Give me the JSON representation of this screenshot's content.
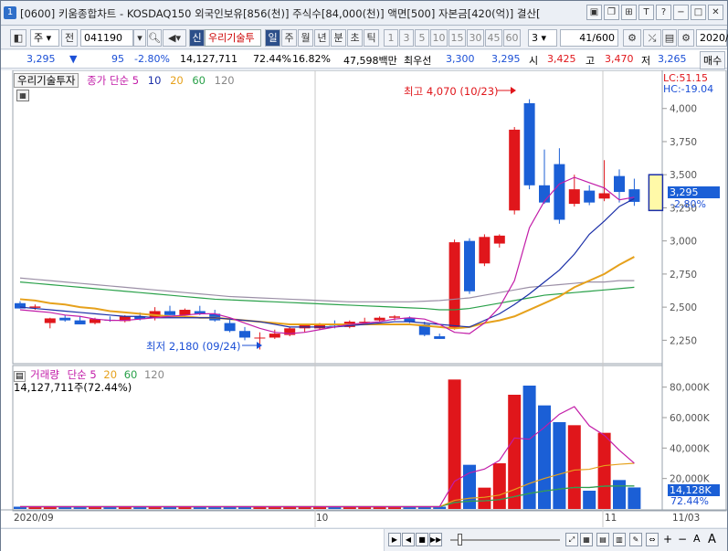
{
  "window": {
    "num": "1",
    "title": "[0600] 키움종합차트 - KOSDAQ150 외국인보유[856(천)] 주식수[84,000(천)] 액면[500] 자본금[420(억)] 결산[",
    "buttons": [
      "minimize-icon",
      "restore-icon",
      "tile-icon",
      "font-icon",
      "help-icon",
      "min-icon",
      "max-icon",
      "close-icon"
    ]
  },
  "toolbar": {
    "period": "주",
    "prev": "전",
    "code": "041190",
    "badge": "신",
    "name": "우리기술투",
    "timeframes": [
      "일",
      "주",
      "월",
      "년",
      "분",
      "초",
      "틱"
    ],
    "minutes": [
      "1",
      "3",
      "5",
      "10",
      "15",
      "30",
      "45",
      "60"
    ],
    "interval": "3",
    "count": "41/600",
    "date": "2020/"
  },
  "pricebar": {
    "price": "3,295",
    "arrow": "▼",
    "change": "95",
    "change_pct": "-2.80%",
    "volume": "14,127,711",
    "vol_ratio": "72.44%",
    "turnover": "16.82%",
    "amount": "47,598백만",
    "best_label": "최우선",
    "ask": "3,300",
    "bid": "3,295",
    "open_label": "시",
    "open": "3,425",
    "high_label": "고",
    "high": "3,470",
    "low_label": "저",
    "low": "3,265",
    "right_btn": "매수"
  },
  "price_legend": {
    "name": "우리기술투자",
    "ma_label": "종가 단순",
    "periods": [
      "5",
      "10",
      "20",
      "60",
      "120"
    ],
    "lc": "LC:51.15",
    "hc": "HC:-19.04",
    "high_note": "최고 4,070 (10/23)",
    "low_note": "최저 2,180 (09/24)",
    "last_price": "3,295",
    "last_pct": "-2.80%"
  },
  "volume_legend": {
    "label": "거래량",
    "ma_label": "단순",
    "periods": [
      "5",
      "20",
      "60",
      "120"
    ],
    "value": "14,127,711주(72.44%)",
    "last_volume": "14,128K",
    "last_pct": "72.44%"
  },
  "x_axis": {
    "labels": [
      "2020/09",
      "10",
      "11",
      "11/03"
    ]
  },
  "colors": {
    "up": "#e0161b",
    "down": "#1b5fd6",
    "ma5": "#c21ca8",
    "ma10": "#1b2fa8",
    "ma20": "#e6a11c",
    "ma60": "#2aa14a",
    "ma120": "#9b8fa6"
  },
  "chart_data": {
    "type": "candlestick",
    "y_price_ticks": [
      "4,000",
      "3,750",
      "3,500",
      "3,250",
      "3,000",
      "2,750",
      "2,500",
      "2,250"
    ],
    "y_price_range": [
      2080,
      4150
    ],
    "y_volume_ticks": [
      "80,000K",
      "60,000K",
      "40,000K",
      "20,000K"
    ],
    "y_volume_range": [
      0,
      90000
    ],
    "candles": [
      {
        "o": 2530,
        "h": 2545,
        "l": 2490,
        "c": 2490,
        "v": 1500
      },
      {
        "o": 2495,
        "h": 2520,
        "l": 2480,
        "c": 2505,
        "v": 1500
      },
      {
        "o": 2380,
        "h": 2420,
        "l": 2340,
        "c": 2415,
        "v": 1500
      },
      {
        "o": 2420,
        "h": 2440,
        "l": 2390,
        "c": 2400,
        "v": 1500
      },
      {
        "o": 2400,
        "h": 2430,
        "l": 2370,
        "c": 2370,
        "v": 1500
      },
      {
        "o": 2380,
        "h": 2420,
        "l": 2370,
        "c": 2410,
        "v": 1500
      },
      {
        "o": 2405,
        "h": 2430,
        "l": 2390,
        "c": 2400,
        "v": 1500
      },
      {
        "o": 2395,
        "h": 2440,
        "l": 2385,
        "c": 2430,
        "v": 1500
      },
      {
        "o": 2430,
        "h": 2460,
        "l": 2400,
        "c": 2410,
        "v": 1500
      },
      {
        "o": 2420,
        "h": 2500,
        "l": 2400,
        "c": 2470,
        "v": 1500
      },
      {
        "o": 2470,
        "h": 2510,
        "l": 2440,
        "c": 2440,
        "v": 1500
      },
      {
        "o": 2440,
        "h": 2490,
        "l": 2420,
        "c": 2480,
        "v": 1500
      },
      {
        "o": 2470,
        "h": 2510,
        "l": 2440,
        "c": 2450,
        "v": 1500
      },
      {
        "o": 2450,
        "h": 2480,
        "l": 2390,
        "c": 2400,
        "v": 1500
      },
      {
        "o": 2380,
        "h": 2420,
        "l": 2310,
        "c": 2320,
        "v": 1500
      },
      {
        "o": 2320,
        "h": 2350,
        "l": 2250,
        "c": 2270,
        "v": 1500
      },
      {
        "o": 2270,
        "h": 2310,
        "l": 2180,
        "c": 2270,
        "v": 1500
      },
      {
        "o": 2270,
        "h": 2330,
        "l": 2260,
        "c": 2300,
        "v": 1500
      },
      {
        "o": 2290,
        "h": 2350,
        "l": 2280,
        "c": 2340,
        "v": 1500
      },
      {
        "o": 2340,
        "h": 2370,
        "l": 2310,
        "c": 2370,
        "v": 1500
      },
      {
        "o": 2340,
        "h": 2380,
        "l": 2330,
        "c": 2370,
        "v": 1500
      },
      {
        "o": 2370,
        "h": 2400,
        "l": 2340,
        "c": 2360,
        "v": 1500
      },
      {
        "o": 2350,
        "h": 2400,
        "l": 2340,
        "c": 2390,
        "v": 1500
      },
      {
        "o": 2390,
        "h": 2420,
        "l": 2370,
        "c": 2390,
        "v": 1500
      },
      {
        "o": 2400,
        "h": 2430,
        "l": 2390,
        "c": 2420,
        "v": 1500
      },
      {
        "o": 2420,
        "h": 2440,
        "l": 2400,
        "c": 2430,
        "v": 1500
      },
      {
        "o": 2420,
        "h": 2430,
        "l": 2380,
        "c": 2390,
        "v": 1500
      },
      {
        "o": 2370,
        "h": 2390,
        "l": 2280,
        "c": 2290,
        "v": 1500
      },
      {
        "o": 2280,
        "h": 2300,
        "l": 2260,
        "c": 2260,
        "v": 1500
      },
      {
        "o": 2340,
        "h": 3010,
        "l": 2330,
        "c": 2990,
        "v": 85000
      },
      {
        "o": 3000,
        "h": 3020,
        "l": 2600,
        "c": 2620,
        "v": 29000
      },
      {
        "o": 2830,
        "h": 3050,
        "l": 2810,
        "c": 3030,
        "v": 14000
      },
      {
        "o": 2980,
        "h": 3050,
        "l": 2950,
        "c": 3040,
        "v": 30000
      },
      {
        "o": 3230,
        "h": 3860,
        "l": 3200,
        "c": 3840,
        "v": 75000
      },
      {
        "o": 4040,
        "h": 4070,
        "l": 3390,
        "c": 3420,
        "v": 81000
      },
      {
        "o": 3420,
        "h": 3690,
        "l": 3280,
        "c": 3290,
        "v": 68000
      },
      {
        "o": 3580,
        "h": 3700,
        "l": 3130,
        "c": 3160,
        "v": 57000
      },
      {
        "o": 3280,
        "h": 3500,
        "l": 3260,
        "c": 3390,
        "v": 55000
      },
      {
        "o": 3380,
        "h": 3420,
        "l": 3270,
        "c": 3290,
        "v": 12000
      },
      {
        "o": 3320,
        "h": 3610,
        "l": 3300,
        "c": 3360,
        "v": 50000
      },
      {
        "o": 3490,
        "h": 3540,
        "l": 3290,
        "c": 3370,
        "v": 19000
      },
      {
        "o": 3390,
        "h": 3470,
        "l": 3265,
        "c": 3295,
        "v": 14128
      }
    ],
    "ma5": [
      2480,
      2470,
      2460,
      2440,
      2430,
      2410,
      2400,
      2400,
      2410,
      2420,
      2430,
      2440,
      2450,
      2450,
      2420,
      2380,
      2340,
      2310,
      2300,
      2310,
      2330,
      2350,
      2370,
      2380,
      2390,
      2410,
      2420,
      2410,
      2370,
      2310,
      2300,
      2380,
      2500,
      2700,
      3100,
      3300,
      3430,
      3480,
      3440,
      3400,
      3310,
      3330
    ],
    "ma10": [
      2500,
      2490,
      2480,
      2470,
      2460,
      2450,
      2440,
      2430,
      2430,
      2420,
      2420,
      2420,
      2420,
      2420,
      2410,
      2400,
      2390,
      2370,
      2350,
      2350,
      2350,
      2350,
      2360,
      2370,
      2380,
      2390,
      2390,
      2380,
      2370,
      2360,
      2350,
      2400,
      2450,
      2520,
      2600,
      2690,
      2780,
      2900,
      3050,
      3150,
      3260,
      3320
    ],
    "ma20": [
      2560,
      2550,
      2530,
      2520,
      2500,
      2490,
      2470,
      2460,
      2450,
      2440,
      2430,
      2430,
      2420,
      2420,
      2410,
      2400,
      2390,
      2380,
      2370,
      2370,
      2370,
      2370,
      2370,
      2370,
      2370,
      2370,
      2370,
      2360,
      2350,
      2340,
      2350,
      2380,
      2400,
      2430,
      2480,
      2530,
      2580,
      2650,
      2700,
      2750,
      2820,
      2880
    ],
    "ma60": [
      2690,
      2680,
      2670,
      2660,
      2650,
      2640,
      2630,
      2620,
      2610,
      2600,
      2590,
      2580,
      2570,
      2560,
      2555,
      2550,
      2545,
      2540,
      2535,
      2530,
      2525,
      2520,
      2515,
      2510,
      2505,
      2500,
      2495,
      2490,
      2480,
      2480,
      2490,
      2510,
      2530,
      2550,
      2570,
      2590,
      2600,
      2610,
      2620,
      2630,
      2640,
      2650
    ],
    "ma120": [
      2720,
      2710,
      2700,
      2690,
      2680,
      2670,
      2660,
      2650,
      2640,
      2630,
      2620,
      2610,
      2600,
      2590,
      2580,
      2575,
      2570,
      2565,
      2560,
      2555,
      2550,
      2545,
      2540,
      2540,
      2540,
      2540,
      2540,
      2545,
      2550,
      2560,
      2570,
      2590,
      2610,
      2630,
      2650,
      2660,
      2670,
      2680,
      2690,
      2690,
      2700,
      2700
    ]
  }
}
